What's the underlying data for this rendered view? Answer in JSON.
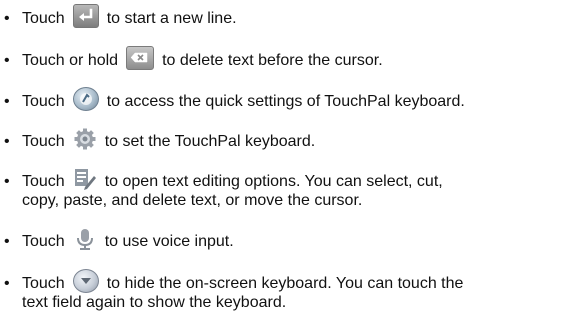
{
  "items": [
    {
      "icon": "enter-icon",
      "before": "Touch",
      "after": "to start a new line.",
      "after2": ""
    },
    {
      "icon": "backspace-icon",
      "before": "Touch or hold",
      "after": "to delete text before the cursor.",
      "after2": ""
    },
    {
      "icon": "quick-settings-icon",
      "before": "Touch",
      "after": "to access the quick settings of TouchPal keyboard.",
      "after2": ""
    },
    {
      "icon": "gear-icon",
      "before": "Touch",
      "after": "to set the TouchPal keyboard.",
      "after2": ""
    },
    {
      "icon": "text-edit-icon",
      "before": "Touch",
      "after": "to open text editing options. You can select, cut,",
      "after2": "copy, paste, and delete text, or move the cursor."
    },
    {
      "icon": "mic-icon",
      "before": "Touch",
      "after": "to use voice input.",
      "after2": ""
    },
    {
      "icon": "hide-keyboard-icon",
      "before": "Touch",
      "after": "to hide the on-screen keyboard. You can touch the",
      "after2": "text field again to show the keyboard."
    }
  ],
  "bullet": "•"
}
